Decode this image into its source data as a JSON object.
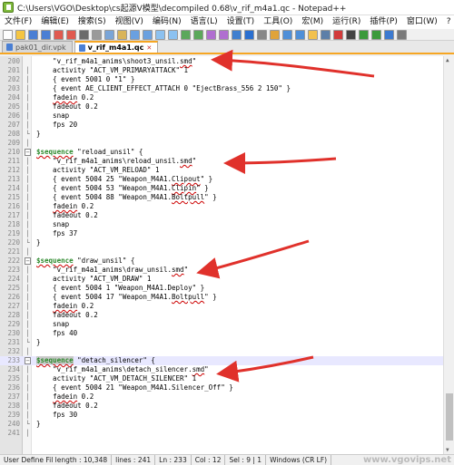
{
  "window": {
    "title": "C:\\Users\\VGO\\Desktop\\cs起源V模型\\decompiled 0.68\\v_rif_m4a1.qc - Notepad++"
  },
  "menu": [
    "文件(F)",
    "编辑(E)",
    "搜索(S)",
    "视图(V)",
    "编码(N)",
    "语言(L)",
    "设置(T)",
    "工具(O)",
    "宏(M)",
    "运行(R)",
    "插件(P)",
    "窗口(W)",
    "?"
  ],
  "menu_close": "X",
  "toolbar_icons": [
    "new-icon",
    "open-icon",
    "save-icon",
    "save-all-icon",
    "close-icon",
    "close-all-icon",
    "print-icon",
    "cut-icon",
    "copy-icon",
    "paste-icon",
    "undo-icon",
    "redo-icon",
    "find-icon",
    "replace-icon",
    "zoom-in-icon",
    "zoom-out-icon",
    "sync-v-icon",
    "sync-h-icon",
    "wrap-icon",
    "all-chars-icon",
    "indent-guide-icon",
    "udl-icon",
    "doc-map-icon",
    "func-list-icon",
    "folder-icon",
    "monitor-icon",
    "record-icon",
    "stop-icon",
    "play-icon",
    "play-multi-icon",
    "save-macro-icon",
    "spell-icon"
  ],
  "tabs": [
    {
      "label": "pak01_dir.vpk",
      "active": false
    },
    {
      "label": "v_rif_m4a1.qc",
      "active": true
    }
  ],
  "lines": [
    {
      "n": "200",
      "fold": "",
      "parts": [
        {
          "t": "    \"v_rif_m4a1_anims\\shoot3_unsil.",
          "c": ""
        },
        {
          "t": "smd",
          "c": "ul"
        },
        {
          "t": "\"",
          "c": ""
        }
      ]
    },
    {
      "n": "201",
      "fold": "",
      "parts": [
        {
          "t": "    activity \"ACT_VM_PRIMARYATTACK\" 1",
          "c": ""
        }
      ]
    },
    {
      "n": "202",
      "fold": "",
      "parts": [
        {
          "t": "    { event 5001 0 \"1\" }",
          "c": ""
        }
      ]
    },
    {
      "n": "203",
      "fold": "",
      "parts": [
        {
          "t": "    { event AE_CLIENT_EFFECT_ATTACH 0 \"EjectBrass_556 2 150\" }",
          "c": ""
        }
      ]
    },
    {
      "n": "204",
      "fold": "",
      "parts": [
        {
          "t": "    ",
          "c": ""
        },
        {
          "t": "fadein",
          "c": "ul"
        },
        {
          "t": " 0.2",
          "c": ""
        }
      ]
    },
    {
      "n": "205",
      "fold": "",
      "parts": [
        {
          "t": "    fadeout 0.2",
          "c": ""
        }
      ]
    },
    {
      "n": "206",
      "fold": "",
      "parts": [
        {
          "t": "    snap",
          "c": ""
        }
      ]
    },
    {
      "n": "207",
      "fold": "",
      "parts": [
        {
          "t": "    fps 20",
          "c": ""
        }
      ]
    },
    {
      "n": "208",
      "fold": "end",
      "parts": [
        {
          "t": "}",
          "c": ""
        }
      ]
    },
    {
      "n": "209",
      "fold": "",
      "parts": [
        {
          "t": "",
          "c": ""
        }
      ]
    },
    {
      "n": "210",
      "fold": "box",
      "parts": [
        {
          "t": "$sequence",
          "c": "kw ul"
        },
        {
          "t": " \"reload_unsil\" {",
          "c": ""
        }
      ]
    },
    {
      "n": "211",
      "fold": "",
      "parts": [
        {
          "t": "    \"v_rif_m4a1_anims\\reload_unsil.",
          "c": ""
        },
        {
          "t": "smd",
          "c": "ul"
        },
        {
          "t": "\"",
          "c": ""
        }
      ]
    },
    {
      "n": "212",
      "fold": "",
      "parts": [
        {
          "t": "    activity \"ACT_VM_RELOAD\" 1",
          "c": ""
        }
      ]
    },
    {
      "n": "213",
      "fold": "",
      "parts": [
        {
          "t": "    { event 5004 25 \"Weapon_M4A1.",
          "c": ""
        },
        {
          "t": "Clipout",
          "c": "ul"
        },
        {
          "t": "\" }",
          "c": ""
        }
      ]
    },
    {
      "n": "214",
      "fold": "",
      "parts": [
        {
          "t": "    { event 5004 53 \"Weapon_M4A1.",
          "c": ""
        },
        {
          "t": "Clipin",
          "c": "ul"
        },
        {
          "t": "\" }",
          "c": ""
        }
      ]
    },
    {
      "n": "215",
      "fold": "",
      "parts": [
        {
          "t": "    { event 5004 88 \"Weapon_M4A1.",
          "c": ""
        },
        {
          "t": "Boltpull",
          "c": "ul"
        },
        {
          "t": "\" }",
          "c": ""
        }
      ]
    },
    {
      "n": "216",
      "fold": "",
      "parts": [
        {
          "t": "    ",
          "c": ""
        },
        {
          "t": "fadein",
          "c": "ul"
        },
        {
          "t": " 0.2",
          "c": ""
        }
      ]
    },
    {
      "n": "217",
      "fold": "",
      "parts": [
        {
          "t": "    fadeout 0.2",
          "c": ""
        }
      ]
    },
    {
      "n": "218",
      "fold": "",
      "parts": [
        {
          "t": "    snap",
          "c": ""
        }
      ]
    },
    {
      "n": "219",
      "fold": "",
      "parts": [
        {
          "t": "    fps 37",
          "c": ""
        }
      ]
    },
    {
      "n": "220",
      "fold": "end",
      "parts": [
        {
          "t": "}",
          "c": ""
        }
      ]
    },
    {
      "n": "221",
      "fold": "",
      "parts": [
        {
          "t": "",
          "c": ""
        }
      ]
    },
    {
      "n": "222",
      "fold": "box",
      "parts": [
        {
          "t": "$sequence",
          "c": "kw ul"
        },
        {
          "t": " \"draw_unsil\" {",
          "c": ""
        }
      ]
    },
    {
      "n": "223",
      "fold": "",
      "parts": [
        {
          "t": "    \"v_rif_m4a1_anims\\draw_unsil.",
          "c": ""
        },
        {
          "t": "smd",
          "c": "ul"
        },
        {
          "t": "\"",
          "c": ""
        }
      ]
    },
    {
      "n": "224",
      "fold": "",
      "parts": [
        {
          "t": "    activity \"ACT_VM_DRAW\" 1",
          "c": ""
        }
      ]
    },
    {
      "n": "225",
      "fold": "",
      "parts": [
        {
          "t": "    { event 5004 1 \"Weapon_M4A1.Deploy\" }",
          "c": ""
        }
      ]
    },
    {
      "n": "226",
      "fold": "",
      "parts": [
        {
          "t": "    { event 5004 17 \"Weapon_M4A1.",
          "c": ""
        },
        {
          "t": "Boltpull",
          "c": "ul"
        },
        {
          "t": "\" }",
          "c": ""
        }
      ]
    },
    {
      "n": "227",
      "fold": "",
      "parts": [
        {
          "t": "    ",
          "c": ""
        },
        {
          "t": "fadein",
          "c": "ul"
        },
        {
          "t": " 0.2",
          "c": ""
        }
      ]
    },
    {
      "n": "228",
      "fold": "",
      "parts": [
        {
          "t": "    fadeout 0.2",
          "c": ""
        }
      ]
    },
    {
      "n": "229",
      "fold": "",
      "parts": [
        {
          "t": "    snap",
          "c": ""
        }
      ]
    },
    {
      "n": "230",
      "fold": "",
      "parts": [
        {
          "t": "    fps 40",
          "c": ""
        }
      ]
    },
    {
      "n": "231",
      "fold": "end",
      "parts": [
        {
          "t": "}",
          "c": ""
        }
      ]
    },
    {
      "n": "232",
      "fold": "",
      "parts": [
        {
          "t": "",
          "c": ""
        }
      ]
    },
    {
      "n": "233",
      "fold": "box",
      "current": true,
      "parts": [
        {
          "t": "$sequence",
          "c": "kw ul hl"
        },
        {
          "t": " \"detach_silencer\" {",
          "c": ""
        }
      ]
    },
    {
      "n": "234",
      "fold": "",
      "parts": [
        {
          "t": "    \"v_rif_m4a1_anims\\detach_silencer.",
          "c": ""
        },
        {
          "t": "smd",
          "c": "ul"
        },
        {
          "t": "\"",
          "c": ""
        }
      ]
    },
    {
      "n": "235",
      "fold": "",
      "parts": [
        {
          "t": "    activity \"ACT_VM_DETACH_SILENCER\" 1",
          "c": ""
        }
      ]
    },
    {
      "n": "236",
      "fold": "",
      "parts": [
        {
          "t": "    { event 5004 21 \"Weapon_M4A1.Silencer_Off\" }",
          "c": ""
        }
      ]
    },
    {
      "n": "237",
      "fold": "",
      "parts": [
        {
          "t": "    ",
          "c": ""
        },
        {
          "t": "fadein",
          "c": "ul"
        },
        {
          "t": " 0.2",
          "c": ""
        }
      ]
    },
    {
      "n": "238",
      "fold": "",
      "parts": [
        {
          "t": "    fadeout 0.2",
          "c": ""
        }
      ]
    },
    {
      "n": "239",
      "fold": "",
      "parts": [
        {
          "t": "    fps 30",
          "c": ""
        }
      ]
    },
    {
      "n": "240",
      "fold": "end",
      "parts": [
        {
          "t": "}",
          "c": ""
        }
      ]
    },
    {
      "n": "241",
      "fold": "",
      "parts": [
        {
          "t": "",
          "c": ""
        }
      ]
    }
  ],
  "status": {
    "type": "User Define Fil length : 10,348",
    "lines": "lines : 241",
    "pos": "Ln : 233",
    "col": "Col : 12",
    "sel": "Sel : 9 | 1",
    "eol": "Windows (CR LF)",
    "watermark": "www.vgovips.net"
  },
  "colors": {
    "accent": "#f6a623",
    "keyword": "#2d8a2d",
    "annotation_arrow": "#e0312b",
    "current_line": "#e8e8ff"
  }
}
